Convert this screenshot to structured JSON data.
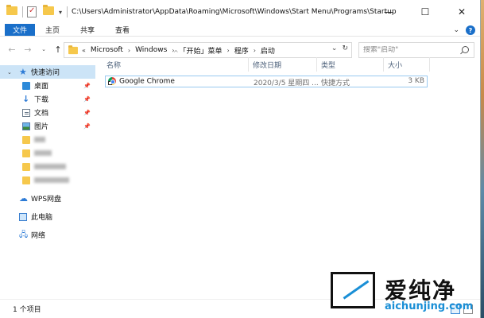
{
  "window": {
    "title_path": "C:\\Users\\Administrator\\AppData\\Roaming\\Microsoft\\Windows\\Start Menu\\Programs\\Startup",
    "controls": {
      "minimize": "—",
      "maximize": "☐",
      "close": "✕"
    }
  },
  "ribbon": {
    "tabs": [
      "文件",
      "主页",
      "共享",
      "查看"
    ]
  },
  "address": {
    "overflow": "«",
    "crumbs": [
      "Microsoft",
      "Windows",
      "「开始」菜单",
      "程序",
      "启动"
    ],
    "separator": "›"
  },
  "search": {
    "placeholder": "搜索\"启动\""
  },
  "nav": {
    "quick_access": "快速访问",
    "items": [
      {
        "label": "桌面",
        "icon": "desktop-icon",
        "pinned": true
      },
      {
        "label": "下载",
        "icon": "download-icon",
        "pinned": true
      },
      {
        "label": "文档",
        "icon": "document-icon",
        "pinned": true
      },
      {
        "label": "图片",
        "icon": "pictures-icon",
        "pinned": true
      }
    ],
    "wps": "WPS网盘",
    "this_pc": "此电脑",
    "network": "网络"
  },
  "columns": {
    "name": "名称",
    "date": "修改日期",
    "type": "类型",
    "size": "大小"
  },
  "files": [
    {
      "name": "Google Chrome",
      "date": "2020/3/5 星期四 ...",
      "type": "快捷方式",
      "size": "3 KB",
      "icon": "chrome-icon"
    }
  ],
  "status": {
    "count": "1 个项目"
  },
  "watermark": {
    "title": "爱纯净",
    "url": "aichunjing.com"
  }
}
